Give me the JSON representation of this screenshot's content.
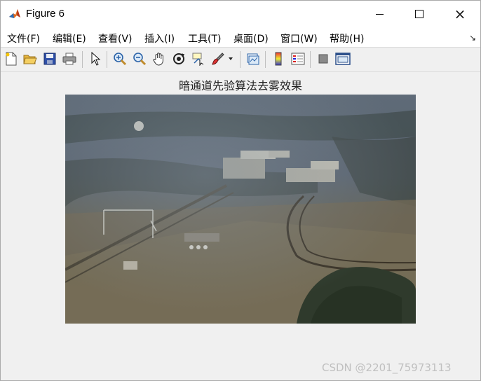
{
  "window": {
    "title": "Figure 6",
    "minimize": "minimize",
    "maximize": "maximize",
    "close": "×"
  },
  "menu": {
    "items": [
      "文件(F)",
      "编辑(E)",
      "查看(V)",
      "插入(I)",
      "工具(T)",
      "桌面(D)",
      "窗口(W)",
      "帮助(H)"
    ],
    "dock_arrow": "↘"
  },
  "toolbar": {
    "icons": [
      "new-figure-icon",
      "open-file-icon",
      "save-icon",
      "print-icon",
      "pointer-icon",
      "zoom-in-icon",
      "zoom-out-icon",
      "pan-hand-icon",
      "rotate-3d-icon",
      "data-cursor-icon",
      "brush-icon",
      "link-plot-icon",
      "colorbar-icon",
      "legend-icon",
      "hide-plot-tools-icon",
      "show-plot-tools-icon"
    ]
  },
  "figure": {
    "title": "暗通道先验算法去雾效果",
    "image_description_colors": {
      "sky_haze": "#5b6672",
      "field": "#6d6a5c",
      "trees": "#2f3a2c"
    }
  },
  "watermark": "CSDN @2201_75973113"
}
